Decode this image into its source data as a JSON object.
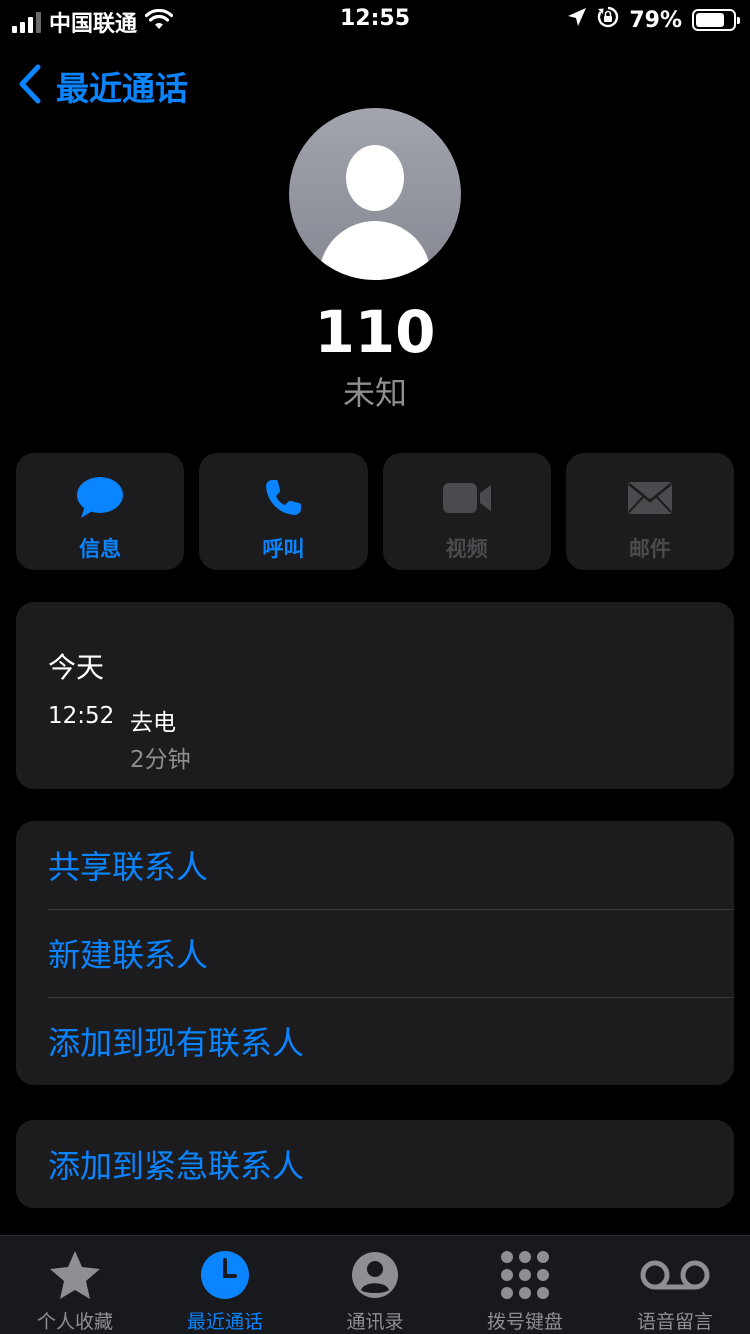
{
  "status_bar": {
    "carrier": "中国联通",
    "time": "12:55",
    "battery_text": "79%",
    "battery_level": 0.79
  },
  "nav": {
    "back_label": "最近通话"
  },
  "contact": {
    "number": "110",
    "subtitle": "未知"
  },
  "actions": [
    {
      "label": "信息",
      "icon": "message-icon",
      "enabled": true
    },
    {
      "label": "呼叫",
      "icon": "phone-icon",
      "enabled": true
    },
    {
      "label": "视频",
      "icon": "video-icon",
      "enabled": false
    },
    {
      "label": "邮件",
      "icon": "mail-icon",
      "enabled": false
    }
  ],
  "call_history": {
    "day": "今天",
    "time": "12:52",
    "type": "去电",
    "duration": "2分钟"
  },
  "contact_options": [
    "共享联系人",
    "新建联系人",
    "添加到现有联系人"
  ],
  "emergency_option": "添加到紧急联系人",
  "tabs": [
    {
      "label": "个人收藏",
      "icon": "star-icon",
      "active": false
    },
    {
      "label": "最近通话",
      "icon": "clock-icon",
      "active": true
    },
    {
      "label": "通讯录",
      "icon": "contacts-icon",
      "active": false
    },
    {
      "label": "拨号键盘",
      "icon": "keypad-icon",
      "active": false
    },
    {
      "label": "语音留言",
      "icon": "voicemail-icon",
      "active": false
    }
  ],
  "colors": {
    "accent": "#0a84ff",
    "background": "#000000",
    "card": "#1c1c1e",
    "secondary_text": "#8e8e93"
  }
}
